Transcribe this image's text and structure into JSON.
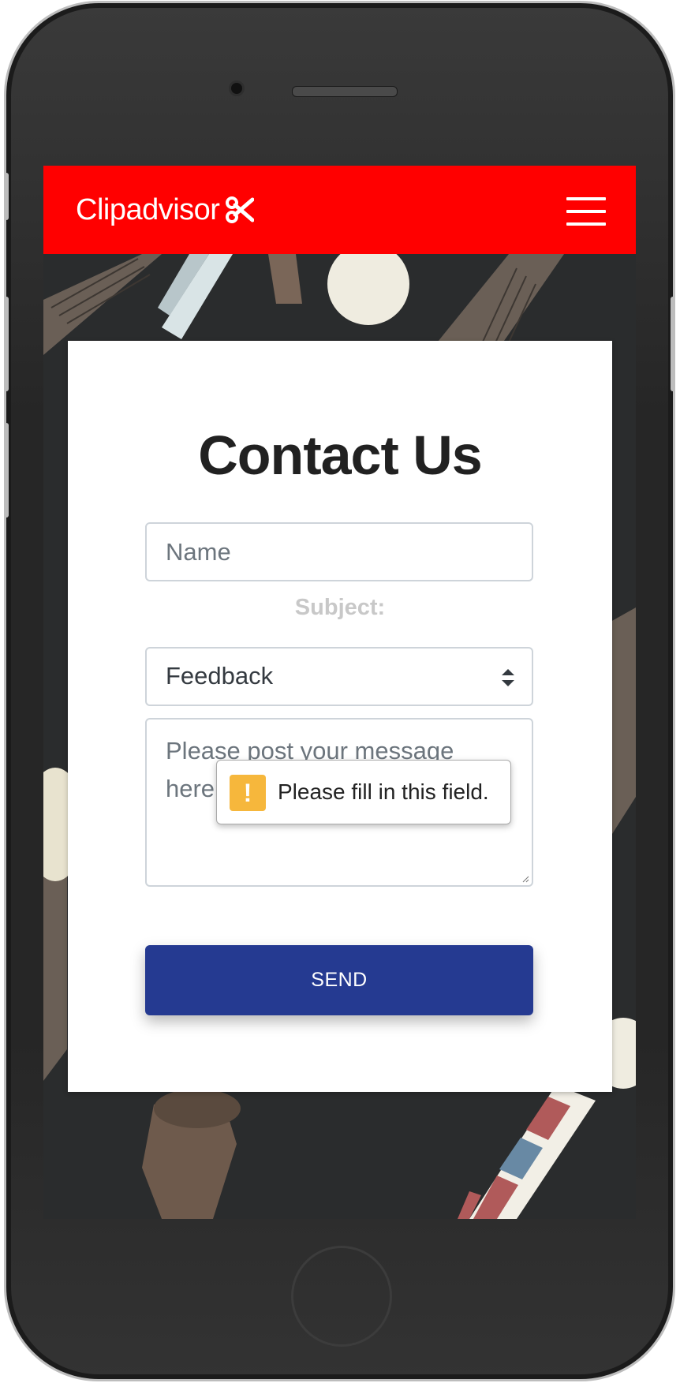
{
  "navbar": {
    "brand": "Clipadvisor",
    "brand_icon": "scissors-icon",
    "menu_icon": "hamburger-menu-icon",
    "background_color": "#ff0000"
  },
  "contact": {
    "title": "Contact Us",
    "name_placeholder": "Name",
    "subject_label": "Subject:",
    "subject_selected": "Feedback",
    "message_placeholder": "Please post your message here...",
    "send_label": "SEND",
    "send_color": "#253a91"
  },
  "validation": {
    "message": "Please fill in this field.",
    "icon": "warning-icon",
    "icon_color": "#f6b73c"
  }
}
